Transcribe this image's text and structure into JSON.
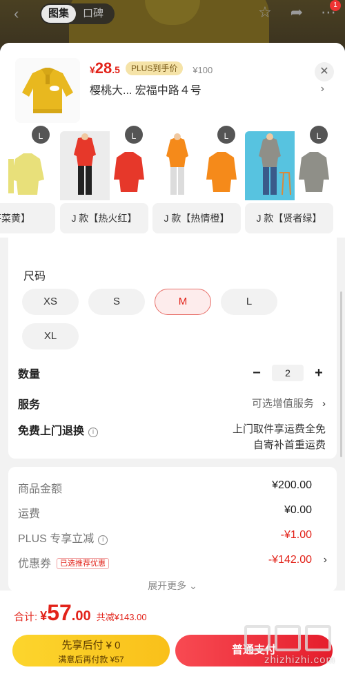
{
  "topbar": {
    "tabs": [
      {
        "label": "图集",
        "active": true
      },
      {
        "label": "口碑",
        "active": false
      }
    ],
    "cart_badge": "1"
  },
  "header": {
    "price_yen": "¥",
    "price_int": "28",
    "price_dec": ".5",
    "plus_tag": "PLUS到手价",
    "orig_price": "¥100",
    "address": "樱桃大...   宏福中路４号"
  },
  "variants": [
    {
      "label": "芹菜黄】",
      "size": "L",
      "color": "#e8e07a"
    },
    {
      "label": "J 款【热火红】",
      "size": "L",
      "color": "#e6382a"
    },
    {
      "label": "J 款【热情橙】",
      "size": "L",
      "color": "#f58a1a"
    },
    {
      "label": "J 款【贤者绿】",
      "size": "L",
      "color": "#8f8f88"
    }
  ],
  "size_section": {
    "title": "尺码",
    "options": [
      {
        "label": "XS",
        "selected": false
      },
      {
        "label": "S",
        "selected": false
      },
      {
        "label": "M",
        "selected": true
      },
      {
        "label": "L",
        "selected": false
      },
      {
        "label": "XL",
        "selected": false
      }
    ]
  },
  "quantity": {
    "label": "数量",
    "value": "2",
    "minus": "−",
    "plus": "+"
  },
  "service": {
    "label": "服务",
    "value": "可选增值服务"
  },
  "return": {
    "label": "免费上门退换",
    "line1": "上门取件享运费全免",
    "line2": "自寄补首重运费"
  },
  "summary": {
    "rows": [
      {
        "label": "商品金额",
        "value": "¥200.00",
        "red": false
      },
      {
        "label": "运费",
        "value": "¥0.00",
        "red": false
      },
      {
        "label": "PLUS 专享立减",
        "value": "-¥1.00",
        "red": true
      },
      {
        "label": "优惠券",
        "value": "-¥142.00",
        "red": true
      }
    ],
    "coupon_tag": "已选推荐优惠",
    "expand": "展开更多"
  },
  "footer": {
    "total_label": "合计:",
    "total_yen": "¥",
    "total_int": "57",
    "total_dec": ".00",
    "total_save": "共减¥143.00",
    "btn_left_l1": "先享后付 ¥ 0",
    "btn_left_l2": "满意后再付款 ¥57",
    "btn_right": "普通支付",
    "watermark": "zhizhizhi.com"
  },
  "colors": {
    "accent_red": "#e2231a",
    "plus_gold": "#f5e3a8",
    "btn_yellow": "#fcd52d",
    "btn_red": "#f84a52"
  }
}
